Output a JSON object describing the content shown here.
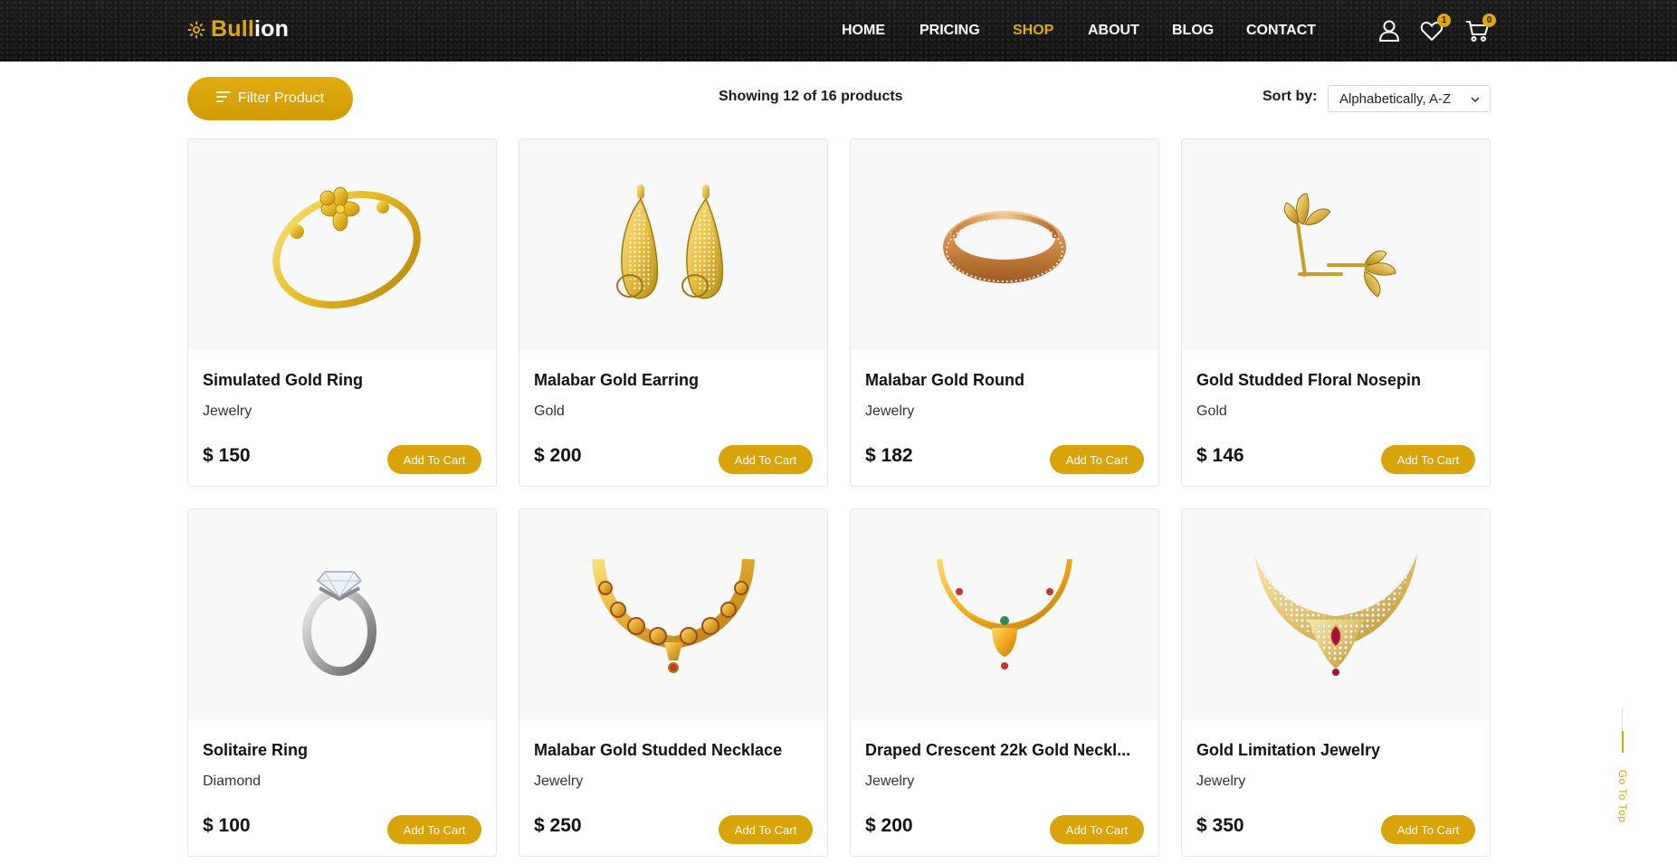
{
  "brand": {
    "prefix": "Bull",
    "suffix": "ion",
    "accent": "#e0a80d"
  },
  "nav": {
    "items": [
      {
        "label": "HOME",
        "active": false
      },
      {
        "label": "PRICING",
        "active": false
      },
      {
        "label": "SHOP",
        "active": true
      },
      {
        "label": "ABOUT",
        "active": false
      },
      {
        "label": "BLOG",
        "active": false
      },
      {
        "label": "CONTACT",
        "active": false
      }
    ],
    "icons": {
      "user": "user-icon",
      "wishlist": "heart-icon",
      "cart": "cart-icon"
    },
    "wishlist_count": "1",
    "cart_count": "0"
  },
  "toolbar": {
    "filter_label": "Filter Product",
    "showing_text": "Showing 12 of 16 products",
    "sort_label": "Sort by:",
    "sort_value": "Alphabetically, A-Z"
  },
  "products": [
    {
      "name": "Simulated Gold Ring",
      "category": "Jewelry",
      "price": "$ 150",
      "cta": "Add To Cart",
      "image": "gold-flower-ring"
    },
    {
      "name": "Malabar Gold Earring",
      "category": "Gold",
      "price": "$ 200",
      "cta": "Add To Cart",
      "image": "gold-drop-earrings"
    },
    {
      "name": "Malabar Gold Round",
      "category": "Jewelry",
      "price": "$ 182",
      "cta": "Add To Cart",
      "image": "rose-gold-band"
    },
    {
      "name": "Gold Studded Floral Nosepin",
      "category": "Gold",
      "price": "$ 146",
      "cta": "Add To Cart",
      "image": "gold-floral-stud"
    },
    {
      "name": "Solitaire Ring",
      "category": "Diamond",
      "price": "$ 100",
      "cta": "Add To Cart",
      "image": "diamond-solitaire-ring"
    },
    {
      "name": "Malabar Gold Studded Necklace",
      "category": "Jewelry",
      "price": "$ 250",
      "cta": "Add To Cart",
      "image": "gold-studded-necklace"
    },
    {
      "name": "Draped Crescent 22k Gold Neckl...",
      "category": "Jewelry",
      "price": "$ 200",
      "cta": "Add To Cart",
      "image": "gold-crescent-necklace"
    },
    {
      "name": "Gold Limitation Jewelry",
      "category": "Jewelry",
      "price": "$ 350",
      "cta": "Add To Cart",
      "image": "diamond-ruby-necklace"
    }
  ],
  "go_top_label": "Go To Top"
}
